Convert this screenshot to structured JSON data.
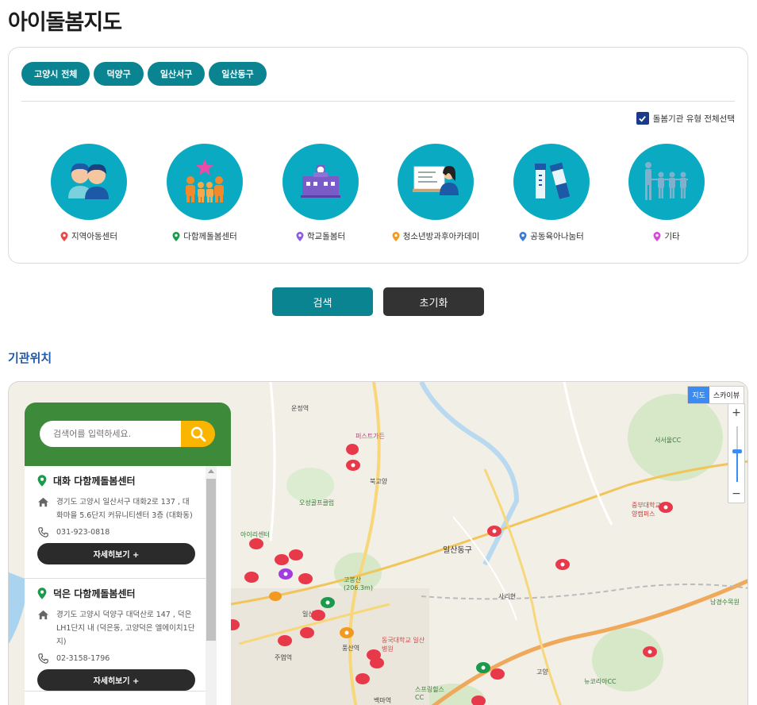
{
  "page_title": "아이돌봄지도",
  "region_tabs": [
    "고양시 전체",
    "덕양구",
    "일산서구",
    "일산동구"
  ],
  "select_all_label": "돌봄기관 유형 전체선택",
  "categories": [
    {
      "label": "지역아동센터",
      "pin_color": "#e84848"
    },
    {
      "label": "다함께돌봄센터",
      "pin_color": "#1a9a4a"
    },
    {
      "label": "학교돌봄터",
      "pin_color": "#8a5ed8"
    },
    {
      "label": "청소년방과후아카데미",
      "pin_color": "#f29a1f"
    },
    {
      "label": "공동육아나눔터",
      "pin_color": "#3a7bd5"
    },
    {
      "label": "기타",
      "pin_color": "#d64bd6"
    }
  ],
  "buttons": {
    "search": "검색",
    "reset": "초기화"
  },
  "section_title": "기관위치",
  "map": {
    "type_map": "지도",
    "type_sky": "스카이뷰",
    "zoom_in": "+",
    "zoom_out": "−",
    "labels": [
      "운정역",
      "퍼스트가든",
      "북고양",
      "오성골프클럽",
      "아이리센터",
      "일산동구",
      "고봉산 (206.3m)",
      "동국대학교 일산병원",
      "풍산역",
      "백마역",
      "주엽역",
      "일산역",
      "서서울CC",
      "중부대학교 고양캠퍼스",
      "남경수목원",
      "뉴코리아CC",
      "고양",
      "사리현",
      "스프링힐스CC"
    ]
  },
  "search": {
    "placeholder": "검색어를 입력하세요."
  },
  "list": [
    {
      "name": "대화 다함께돌봄센터",
      "address": "경기도 고양시 일산서구 대화2로 137 , 대화마을 5.6단지 커뮤니티센터 3층 (대화동)",
      "phone": "031-923-0818",
      "detail_label": "자세히보기 +"
    },
    {
      "name": "덕은 다함께돌봄센터",
      "address": "경기도 고양시 덕양구 대덕산로 147 , 덕은LH1단지 내 (덕은동, 고양덕은 엘에이치1단지)",
      "phone": "02-3158-1796",
      "detail_label": "자세히보기 +"
    }
  ]
}
